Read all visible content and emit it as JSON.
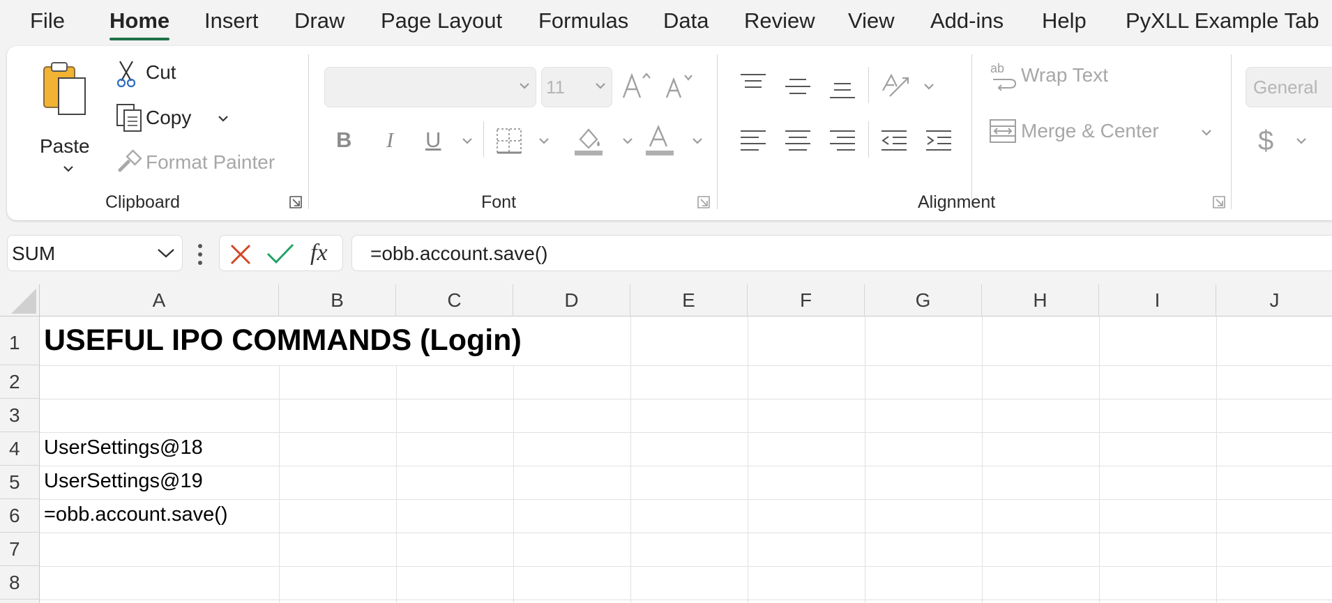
{
  "menu": {
    "tabs": [
      {
        "label": "File"
      },
      {
        "label": "Home",
        "active": true
      },
      {
        "label": "Insert"
      },
      {
        "label": "Draw"
      },
      {
        "label": "Page Layout"
      },
      {
        "label": "Formulas"
      },
      {
        "label": "Data"
      },
      {
        "label": "Review"
      },
      {
        "label": "View"
      },
      {
        "label": "Add-ins"
      },
      {
        "label": "Help"
      },
      {
        "label": "PyXLL Example Tab"
      }
    ]
  },
  "ribbon": {
    "clipboard": {
      "paste": "Paste",
      "cut": "Cut",
      "copy": "Copy",
      "format_painter": "Format Painter",
      "group_label": "Clipboard"
    },
    "font": {
      "font_name": "",
      "font_size": "11",
      "bold": "B",
      "italic": "I",
      "underline": "U",
      "group_label": "Font"
    },
    "alignment": {
      "wrap_text": "Wrap Text",
      "merge_center": "Merge & Center",
      "group_label": "Alignment"
    },
    "number": {
      "format": "General",
      "currency_symbol": "$"
    }
  },
  "formula_bar": {
    "name_box": "SUM",
    "fx_label": "fx",
    "formula": "=obb.account.save()"
  },
  "sheet": {
    "columns": [
      "A",
      "B",
      "C",
      "D",
      "E",
      "F",
      "G",
      "H",
      "I",
      "J"
    ],
    "rows": [
      "1",
      "2",
      "3",
      "4",
      "5",
      "6",
      "7",
      "8"
    ],
    "cells": {
      "A1": "USEFUL IPO COMMANDS (Login)",
      "A4": "UserSettings@18",
      "A5": "UserSettings@19",
      "A6": "=obb.account.save()"
    }
  },
  "colors": {
    "accent": "#1e7145",
    "cancel": "#d24726",
    "enter": "#21a366"
  }
}
